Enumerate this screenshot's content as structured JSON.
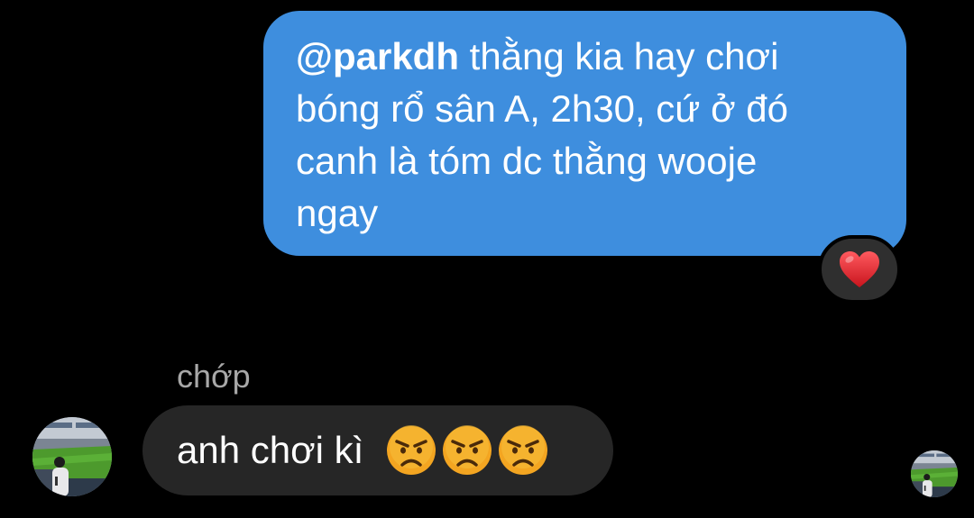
{
  "outgoing_message": {
    "mention": "@parkdh",
    "line1_rest": " thằng kia hay chơi",
    "line2": "bóng rổ sân A, 2h30, cứ ở đó",
    "line3": "canh là tóm dc thằng wooje",
    "line4": "ngay",
    "reaction": "heart-emoji"
  },
  "incoming_message": {
    "sender": "chớp",
    "text": "anh chơi kì ",
    "emojis": [
      "angry-face-emoji",
      "angry-face-emoji",
      "angry-face-emoji"
    ]
  },
  "colors": {
    "background": "#000000",
    "outgoing_bubble": "#3e8ede",
    "incoming_bubble": "#262626",
    "sender_name": "#a8a8a8",
    "reaction_pill": "#2f2f2f",
    "heart": "#e3262e",
    "angry_face": "#f3a521"
  }
}
